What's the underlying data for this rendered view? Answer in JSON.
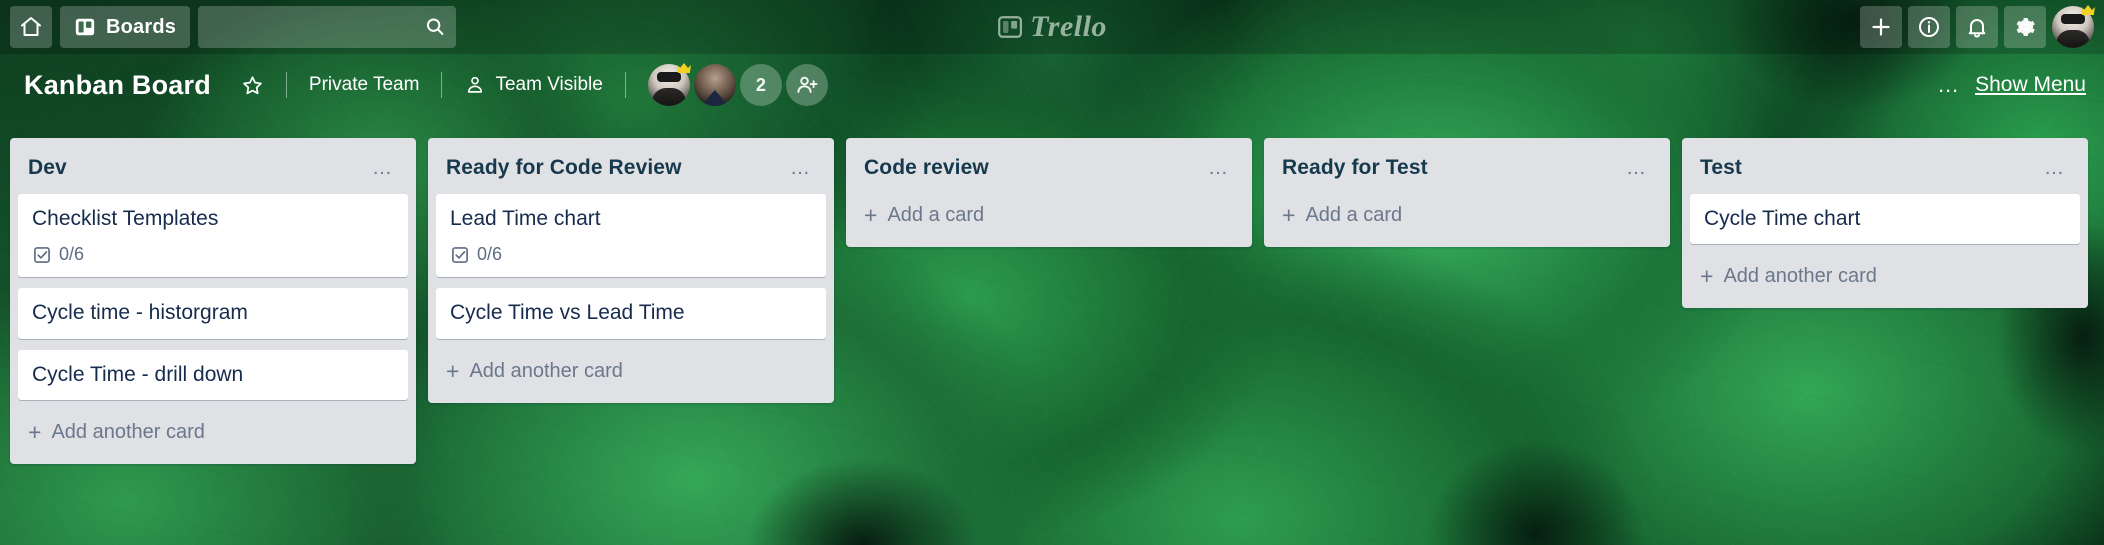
{
  "topbar": {
    "home_icon": "home-icon",
    "boards_button": {
      "label": "Boards",
      "icon": "board-icon"
    },
    "search": {
      "value": "",
      "placeholder": "",
      "icon": "search-icon"
    },
    "brand": {
      "text": "Trello",
      "icon": "trello-logo-icon"
    },
    "actions": [
      {
        "name": "add-button",
        "icon": "plus-icon",
        "glyph": "+"
      },
      {
        "name": "info-button",
        "icon": "info-circle-icon",
        "glyph": "i"
      },
      {
        "name": "notifications-button",
        "icon": "bell-icon",
        "glyph": "bell"
      },
      {
        "name": "settings-button",
        "icon": "gear-icon",
        "glyph": "gear"
      }
    ],
    "user_avatar": {
      "name": "user-avatar",
      "badge": "crown-icon"
    }
  },
  "board_header": {
    "title": "Kanban Board",
    "star_icon": "star-outline-icon",
    "visibility_team": "Private Team",
    "visibility_scope": "Team Visible",
    "visibility_icon": "team-visible-icon",
    "members": [
      {
        "name": "member-avatar-1",
        "badge": "crown-icon"
      },
      {
        "name": "member-avatar-2",
        "badge": ""
      }
    ],
    "member_overflow_count": "2",
    "add_member_icon": "add-member-icon",
    "menu_dots": "…",
    "show_menu_label": "Show Menu"
  },
  "lists": [
    {
      "title": "Dev",
      "menu": "…",
      "add_card_label": "Add another card",
      "cards": [
        {
          "title": "Checklist Templates",
          "badges": [
            {
              "type": "checklist",
              "icon": "checklist-icon",
              "text": "0/6"
            }
          ]
        },
        {
          "title": "Cycle time - historgram",
          "badges": []
        },
        {
          "title": "Cycle Time - drill down",
          "badges": []
        }
      ]
    },
    {
      "title": "Ready for Code Review",
      "menu": "…",
      "add_card_label": "Add another card",
      "cards": [
        {
          "title": "Lead Time chart",
          "badges": [
            {
              "type": "checklist",
              "icon": "checklist-icon",
              "text": "0/6"
            }
          ]
        },
        {
          "title": "Cycle Time vs Lead Time",
          "badges": []
        }
      ]
    },
    {
      "title": "Code review",
      "menu": "…",
      "add_card_label": "Add a card",
      "cards": []
    },
    {
      "title": "Ready for Test",
      "menu": "…",
      "add_card_label": "Add a card",
      "cards": []
    },
    {
      "title": "Test",
      "menu": "…",
      "add_card_label": "Add another card",
      "cards": [
        {
          "title": "Cycle Time chart",
          "badges": []
        }
      ]
    }
  ],
  "colors": {
    "list_background": "#dfe1e4",
    "card_background": "#ffffff",
    "text_dark": "#172b4d",
    "text_muted": "#6b778c",
    "board_green": "#1d7a3c"
  }
}
